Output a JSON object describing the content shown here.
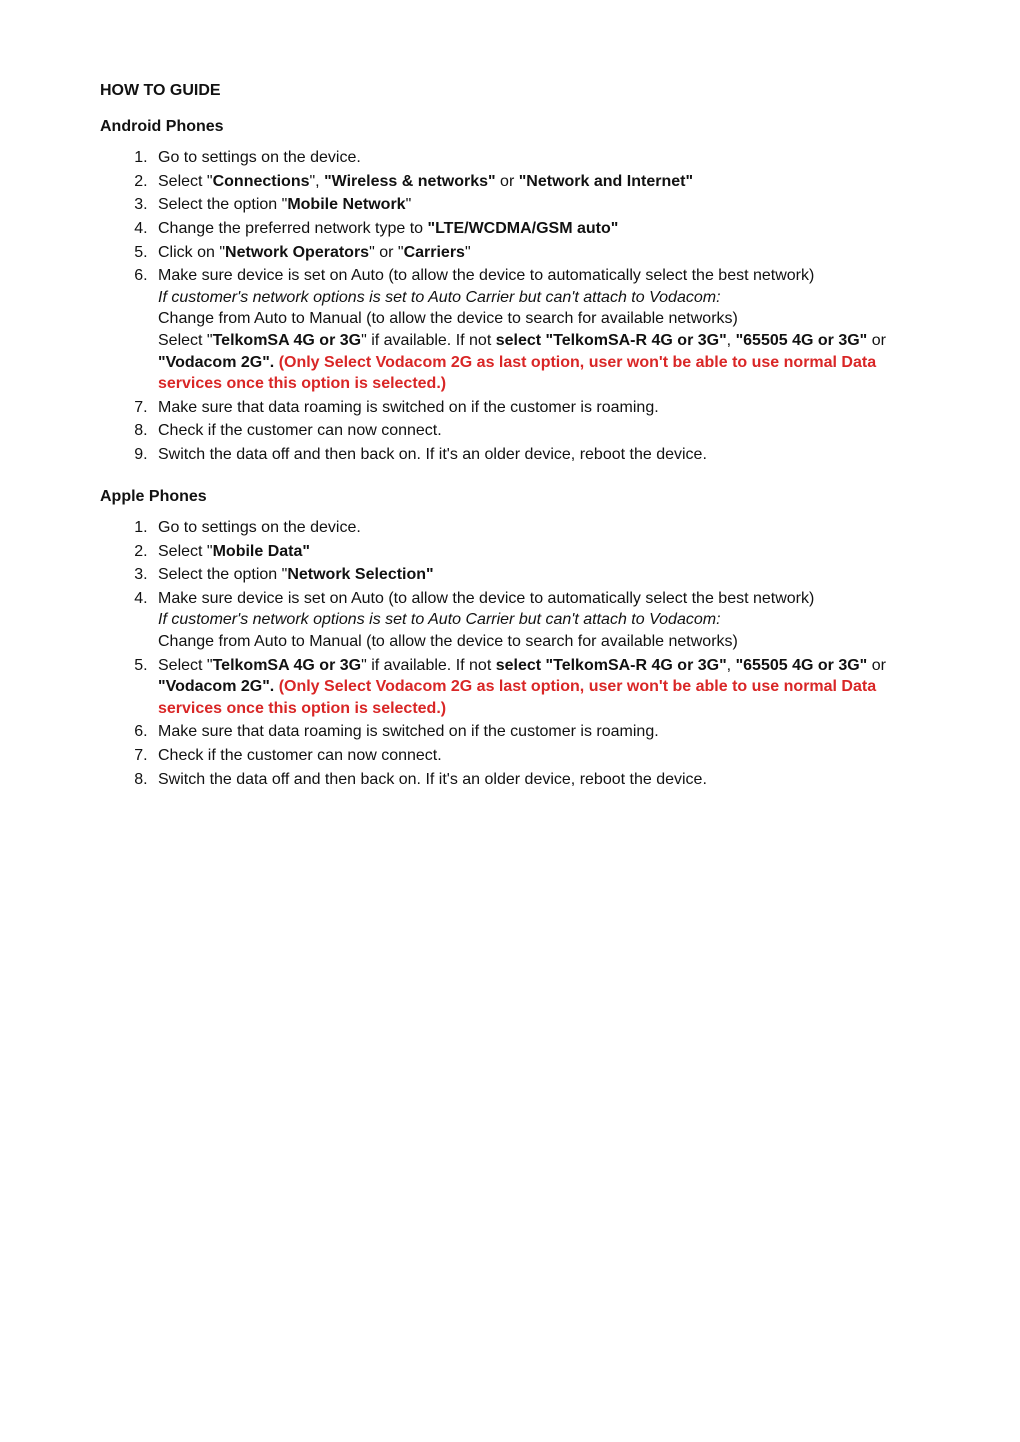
{
  "title": "HOW TO GUIDE",
  "sections": [
    {
      "heading": "Android Phones",
      "steps": [
        [
          {
            "t": "Go to settings on the device."
          }
        ],
        [
          {
            "t": "Select \""
          },
          {
            "t": "Connections",
            "bold": true
          },
          {
            "t": "\", "
          },
          {
            "t": "\"Wireless & networks\"",
            "bold": true
          },
          {
            "t": " or "
          },
          {
            "t": "\"Network and Internet\"",
            "bold": true
          }
        ],
        [
          {
            "t": "Select the option \""
          },
          {
            "t": "Mobile Network",
            "bold": true
          },
          {
            "t": "\""
          }
        ],
        [
          {
            "t": "Change the preferred network type to "
          },
          {
            "t": "\"LTE/WCDMA/GSM auto\"",
            "bold": true
          }
        ],
        [
          {
            "t": "Click on \""
          },
          {
            "t": "Network Operators",
            "bold": true
          },
          {
            "t": "\" or \""
          },
          {
            "t": "Carriers",
            "bold": true
          },
          {
            "t": "\""
          }
        ],
        [
          {
            "t": "Make sure device is set on Auto (to allow the device to automatically select the best network)"
          },
          {
            "br": true
          },
          {
            "t": "If customer's network options is set to Auto Carrier but can't attach to Vodacom:",
            "italic": true
          },
          {
            "br": true
          },
          {
            "t": "Change from Auto to Manual (to allow the device to search for available networks)"
          },
          {
            "br": true
          },
          {
            "t": "Select \""
          },
          {
            "t": "TelkomSA 4G or 3G",
            "bold": true
          },
          {
            "t": "\" if available. If not "
          },
          {
            "t": "select \"TelkomSA-R 4G or 3G\"",
            "bold": true
          },
          {
            "t": ", "
          },
          {
            "t": "\"65505 4G or 3G\"",
            "bold": true
          },
          {
            "t": " or "
          },
          {
            "t": "\"Vodacom 2G\". ",
            "bold": true
          },
          {
            "t": "(Only Select Vodacom 2G as last option, user won't be able to use normal Data services once this option is selected.)",
            "bold": true,
            "red": true
          }
        ],
        [
          {
            "t": "Make sure that data roaming is switched on if the customer is roaming."
          }
        ],
        [
          {
            "t": "Check if the customer can now connect."
          }
        ],
        [
          {
            "t": "Switch the data off and then back on. If it's an older device, reboot the device."
          }
        ]
      ]
    },
    {
      "heading": "Apple Phones",
      "steps": [
        [
          {
            "t": "Go to settings on the device."
          }
        ],
        [
          {
            "t": "Select \""
          },
          {
            "t": "Mobile Data\"",
            "bold": true
          }
        ],
        [
          {
            "t": "Select the option \""
          },
          {
            "t": "Network Selection\"",
            "bold": true
          }
        ],
        [
          {
            "t": "Make sure device is set on Auto (to allow the device to automatically select the best network)"
          },
          {
            "br": true
          },
          {
            "t": "If customer's network options is set to Auto Carrier but can't attach to Vodacom:",
            "italic": true
          },
          {
            "br": true
          },
          {
            "t": "Change from Auto to Manual (to allow the device to search for available networks)"
          }
        ],
        [
          {
            "t": "Select \""
          },
          {
            "t": "TelkomSA 4G or 3G",
            "bold": true
          },
          {
            "t": "\" if available. If not "
          },
          {
            "t": "select \"TelkomSA-R 4G or 3G\"",
            "bold": true
          },
          {
            "t": ", "
          },
          {
            "t": "\"65505 4G or 3G\"",
            "bold": true
          },
          {
            "t": " or "
          },
          {
            "t": "\"Vodacom 2G\". ",
            "bold": true
          },
          {
            "t": "(Only Select Vodacom 2G as last option, user won't be able to use normal Data services once this option is selected.)",
            "bold": true,
            "red": true
          }
        ],
        [
          {
            "t": "Make sure that data roaming is switched on if the customer is roaming."
          }
        ],
        [
          {
            "t": "Check if the customer can now connect."
          }
        ],
        [
          {
            "t": "Switch the data off and then back on. If it's an older device, reboot the device."
          }
        ]
      ]
    }
  ]
}
